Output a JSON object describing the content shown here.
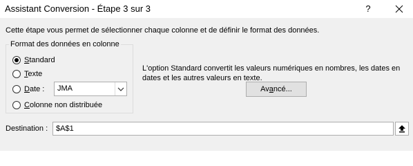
{
  "window": {
    "title": "Assistant Conversion - Étape 3 sur 3",
    "help_label": "?"
  },
  "intro_text": "Cette étape vous permet de sélectionner chaque colonne et de définir le format des données.",
  "column_format": {
    "legend": "Format des données en colonne",
    "options": [
      {
        "pre": "",
        "u": "S",
        "post": "tandard",
        "checked": true
      },
      {
        "pre": "",
        "u": "T",
        "post": "exte",
        "checked": false
      },
      {
        "pre": "",
        "u": "D",
        "post": "ate :",
        "checked": false
      },
      {
        "pre": "",
        "u": "C",
        "post": "olonne non distribuée",
        "checked": false
      }
    ],
    "date_format_value": "JMA"
  },
  "description": "L'option Standard convertit les valeurs numériques en nombres, les dates en dates et les autres valeurs en texte.",
  "advanced_button": {
    "pre": "Av",
    "u": "a",
    "post": "ncé..."
  },
  "destination": {
    "label": "Destination :",
    "value": "$A$1"
  },
  "icons": {
    "close": "close-icon",
    "dropdown": "chevron-down-icon",
    "collapse": "collapse-dialog-icon"
  }
}
